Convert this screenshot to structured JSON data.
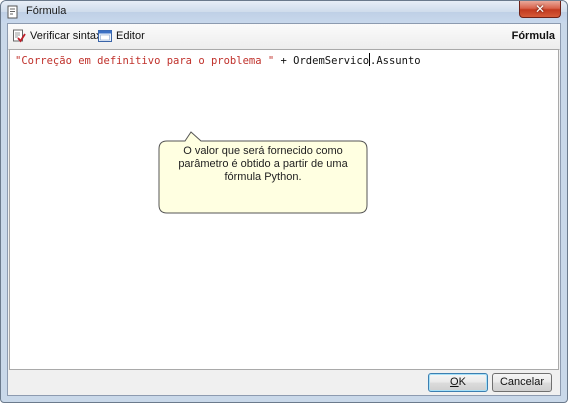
{
  "window": {
    "title": "Fórmula",
    "close_glyph": "✕"
  },
  "toolbar": {
    "check_syntax_label": "Verificar sintaxe",
    "check_syntax_icon": "check-document-icon",
    "editor_label": "Editor",
    "editor_icon": "editor-window-icon",
    "section_label": "Fórmula"
  },
  "editor": {
    "code_string": "\"Correção em definitivo para o problema \"",
    "code_operator": " + ",
    "code_field_before_caret": "OrdemServico",
    "code_field_after_caret": ".Assunto",
    "string_color": "#c0312b"
  },
  "tooltip": {
    "text": "O valor que será fornecido como parâmetro é obtido a partir de uma fórmula Python."
  },
  "buttons": {
    "ok_accel": "O",
    "ok_rest": "K",
    "cancel_label": "Cancelar"
  }
}
